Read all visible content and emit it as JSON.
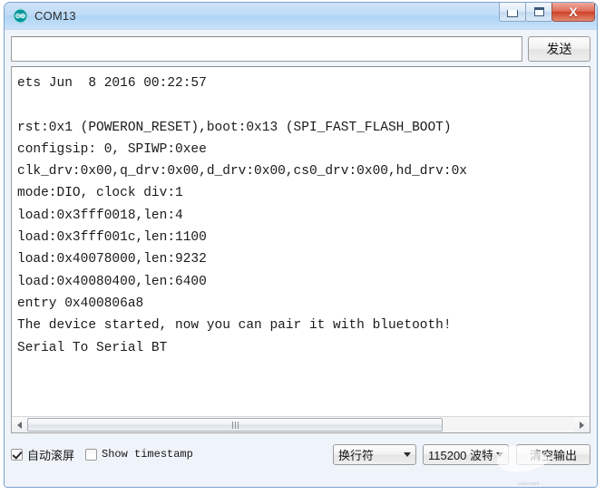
{
  "window": {
    "title": "COM13",
    "icon": "arduino-logo-icon",
    "controls": {
      "minimize": "minimize-icon",
      "maximize": "maximize-icon",
      "close": "X"
    }
  },
  "send_row": {
    "input_value": "",
    "input_placeholder": "",
    "send_label": "发送"
  },
  "console": {
    "lines": [
      "ets Jun  8 2016 00:22:57",
      "",
      "rst:0x1 (POWERON_RESET),boot:0x13 (SPI_FAST_FLASH_BOOT)",
      "configsip: 0, SPIWP:0xee",
      "clk_drv:0x00,q_drv:0x00,d_drv:0x00,cs0_drv:0x00,hd_drv:0x",
      "mode:DIO, clock div:1",
      "load:0x3fff0018,len:4",
      "load:0x3fff001c,len:1100",
      "load:0x40078000,len:9232",
      "load:0x40080400,len:6400",
      "entry 0x400806a8",
      "The device started, now you can pair it with bluetooth!",
      "Serial To Serial BT"
    ],
    "text": "ets Jun  8 2016 00:22:57\n\nrst:0x1 (POWERON_RESET),boot:0x13 (SPI_FAST_FLASH_BOOT)\nconfigsip: 0, SPIWP:0xee\nclk_drv:0x00,q_drv:0x00,d_drv:0x00,cs0_drv:0x00,hd_drv:0x\nmode:DIO, clock div:1\nload:0x3fff0018,len:4\nload:0x3fff001c,len:1100\nload:0x40078000,len:9232\nload:0x40080400,len:6400\nentry 0x400806a8\nThe device started, now you can pair it with bluetooth!\nSerial To Serial BT"
  },
  "scrollbar": {
    "left_arrow": "scroll-left-icon",
    "right_arrow": "scroll-right-icon",
    "thumb_width_pct": "76%"
  },
  "bottom_bar": {
    "autoscroll_label": "自动滚屏",
    "autoscroll_checked": true,
    "timestamp_label": "Show timestamp",
    "timestamp_checked": false,
    "line_ending": "换行符",
    "baud_rate": "115200 波特",
    "clear_label": "清空输出"
  },
  "colors": {
    "titlebar_top": "#cfe3f7",
    "titlebar_bottom": "#c6e1f9",
    "frame_border": "#7da2ce",
    "arduino_teal": "#00979c",
    "close_red": "#cf4227",
    "console_bg": "#ffffff",
    "console_text": "#1a1a1a"
  }
}
